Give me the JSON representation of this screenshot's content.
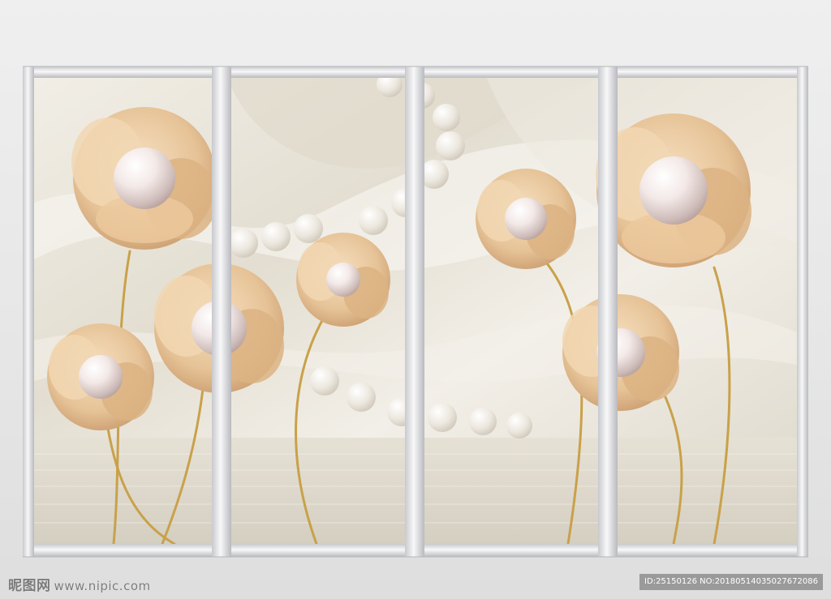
{
  "image": {
    "subject": "mural",
    "colors": {
      "wall": "#e8e8e8",
      "frame": "#d9dadd",
      "satin": "#ebe7dc",
      "petal": "#e9c9a2",
      "petal_dark": "#c99e6e",
      "pearl": "#f5eeec",
      "stem": "#c9a14a",
      "water": "#ddd8cb"
    }
  },
  "watermark": {
    "brand": "昵图网",
    "site": "www.nipic.com",
    "id_text": "ID:25150126 NO:20180514035027672086"
  }
}
